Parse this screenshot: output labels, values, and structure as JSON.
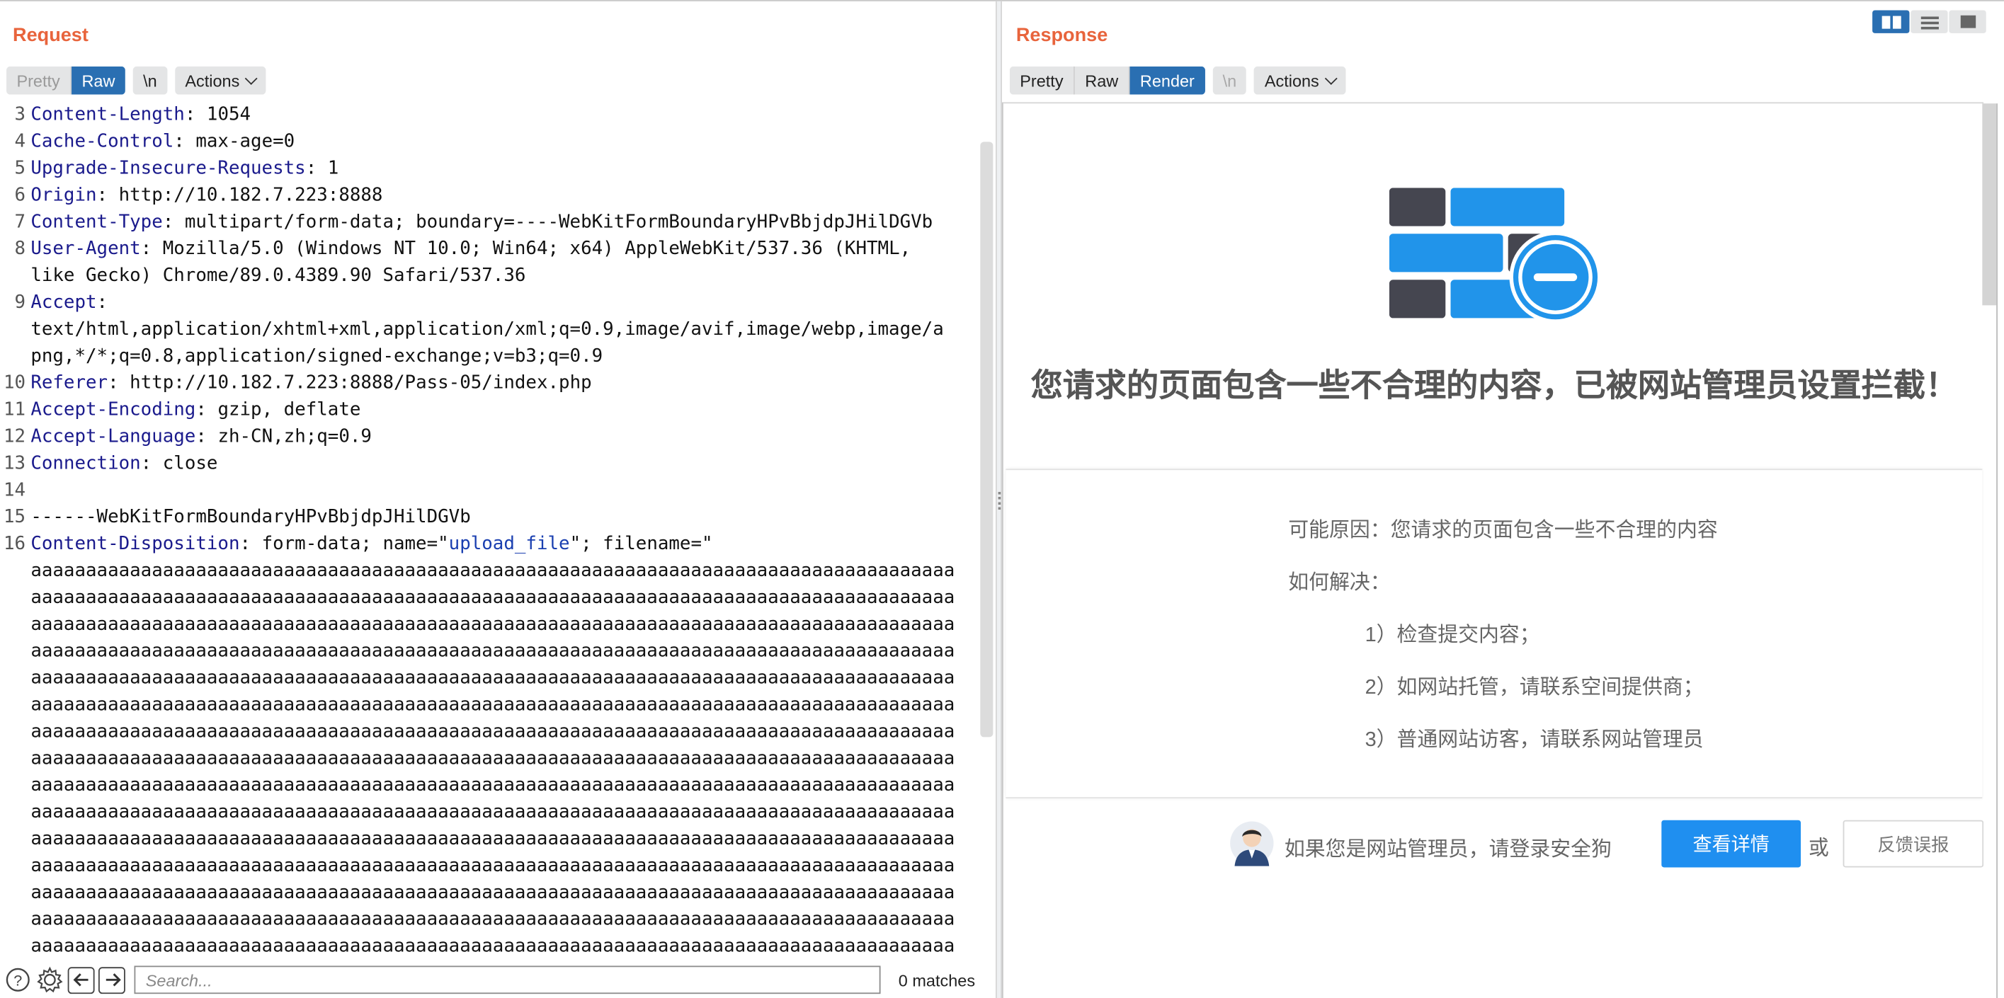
{
  "request": {
    "title": "Request",
    "tabs": [
      "Pretty",
      "Raw"
    ],
    "newline_label": "\\n",
    "actions_label": "Actions",
    "headers": [
      {
        "n": "3",
        "key": "Content-Length",
        "val": " 1054"
      },
      {
        "n": "4",
        "key": "Cache-Control",
        "val": " max-age=0"
      },
      {
        "n": "5",
        "key": "Upgrade-Insecure-Requests",
        "val": " 1"
      },
      {
        "n": "6",
        "key": "Origin",
        "val": " http://10.182.7.223:8888"
      },
      {
        "n": "7",
        "key": "Content-Type",
        "val": " multipart/form-data; boundary=----WebKitFormBoundaryHPvBbjdpJHilDGVb"
      },
      {
        "n": "8",
        "key": "User-Agent",
        "val": " Mozilla/5.0 (Windows NT 10.0; Win64; x64) AppleWebKit/537.36 (KHTML,"
      },
      {
        "n": "",
        "key": "",
        "val": "like Gecko) Chrome/89.0.4389.90 Safari/537.36"
      },
      {
        "n": "9",
        "key": "Accept",
        "val": ""
      },
      {
        "n": "",
        "key": "",
        "val": "text/html,application/xhtml+xml,application/xml;q=0.9,image/avif,image/webp,image/a"
      },
      {
        "n": "",
        "key": "",
        "val": "png,*/*;q=0.8,application/signed-exchange;v=b3;q=0.9"
      },
      {
        "n": "10",
        "key": "Referer",
        "val": " http://10.182.7.223:8888/Pass-05/index.php"
      },
      {
        "n": "11",
        "key": "Accept-Encoding",
        "val": " gzip, deflate"
      },
      {
        "n": "12",
        "key": "Accept-Language",
        "val": " zh-CN,zh;q=0.9"
      },
      {
        "n": "13",
        "key": "Connection",
        "val": " close"
      },
      {
        "n": "14",
        "key": "",
        "val": ""
      },
      {
        "n": "15",
        "key": "",
        "val": "------WebKitFormBoundaryHPvBbjdpJHilDGVb"
      }
    ],
    "line16": {
      "n": "16",
      "key": "Content-Disposition",
      "pre": " form-data; name=\"",
      "field": "upload_file",
      "post": "\"; filename=\""
    },
    "payload_line": "aaaaaaaaaaaaaaaaaaaaaaaaaaaaaaaaaaaaaaaaaaaaaaaaaaaaaaaaaaaaaaaaaaaaaaaaaaaaaaaaaaaa",
    "payload_line_count": 15,
    "search_placeholder": "Search...",
    "matches": "0 matches"
  },
  "response": {
    "title": "Response",
    "tabs": [
      "Pretty",
      "Raw",
      "Render"
    ],
    "newline_label": "\\n",
    "actions_label": "Actions",
    "render": {
      "headline": "您请求的页面包含一些不合理的内容，已被网站管理员设置拦截！",
      "reason": "可能原因：您请求的页面包含一些不合理的内容",
      "how": "如何解决：",
      "steps": [
        "1）检查提交内容；",
        "2）如网站托管，请联系空间提供商；",
        "3）普通网站访客，请联系网站管理员"
      ],
      "footer_text": "如果您是网站管理员，请登录安全狗",
      "detail_button": "查看详情",
      "or": "或",
      "feedback_button": "反馈误报"
    }
  },
  "colors": {
    "accent_orange": "#e8643c",
    "active_blue": "#2a6fb2",
    "button_blue": "#1f8ff0"
  }
}
